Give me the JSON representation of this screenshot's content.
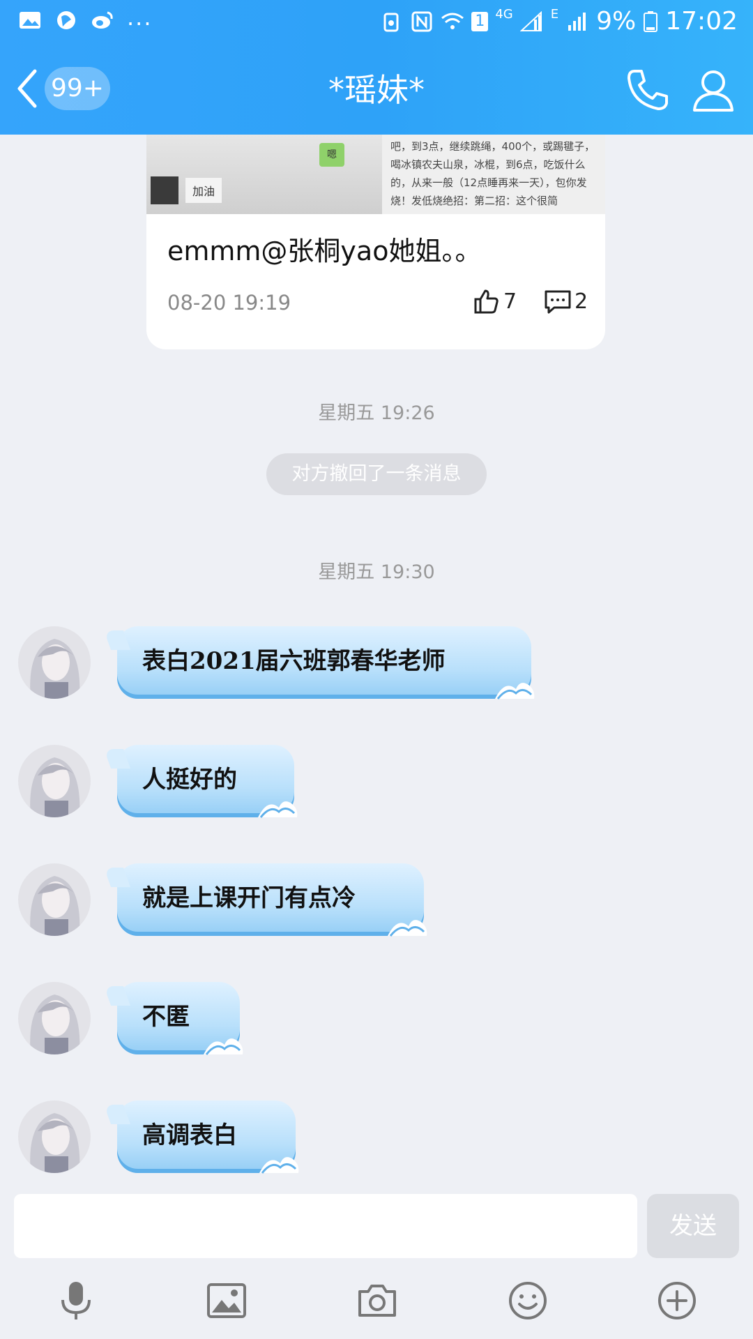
{
  "status_bar": {
    "dots": "...",
    "sim_number": "1",
    "network_4g": "4G",
    "network_e": "E",
    "battery": "9%",
    "time": "17:02"
  },
  "header": {
    "badge": "99+",
    "title": "*瑶妹*"
  },
  "card": {
    "image_green": "嗯",
    "image_cheer": "加油",
    "image_text": "吧，到3点，继续跳绳，400个，或踢毽子，喝冰镇农夫山泉，冰棍，到6点，吃饭什么的，从来一般（12点睡再来一天），包你发烧！发低烧绝招：第二招：这个很简",
    "text": "emmm@张桐yao她姐。。",
    "time": "08-20 19:19",
    "likes": "7",
    "comments": "2"
  },
  "timestamps": [
    "星期五 19:26",
    "星期五 19:30"
  ],
  "recall_notice": "对方撤回了一条消息",
  "messages": [
    {
      "text": "表白2021届六班郭春华老师"
    },
    {
      "text": "人挺好的"
    },
    {
      "text": "就是上课开门有点冷"
    },
    {
      "text": "不匿"
    },
    {
      "text": "高调表白"
    }
  ],
  "input": {
    "send_label": "发送"
  },
  "toolbar_icons": [
    "microphone-icon",
    "image-icon",
    "camera-icon",
    "emoji-icon",
    "plus-icon"
  ],
  "colors": {
    "header": "#2ea2f8",
    "background": "#eef0f5",
    "bubble": "#b9e0fb"
  }
}
